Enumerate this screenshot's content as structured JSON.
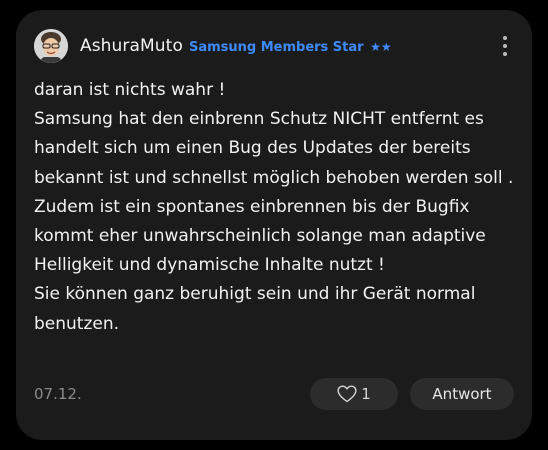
{
  "post": {
    "author": {
      "name": "AshuraMuto",
      "badge": "Samsung Members Star",
      "badge_stars": "★★",
      "avatar_icon": "memoji-avatar-icon"
    },
    "menu_icon": "more-vertical-icon",
    "lines": [
      "daran ist nichts wahr !",
      "Samsung hat den einbrenn Schutz NICHT entfernt es handelt sich um einen Bug des Updates der bereits bekannt ist und schnellst möglich behoben werden soll .",
      "Zudem ist ein spontanes einbrennen bis der Bugfix kommt eher unwahrscheinlich solange man adaptive Helligkeit und dynamische Inhalte nutzt !",
      "Sie können ganz beruhigt sein und ihr Gerät normal benutzen."
    ],
    "date": "07.12.",
    "like": {
      "icon": "heart-icon",
      "count": "1"
    },
    "reply_label": "Antwort"
  },
  "colors": {
    "background": "#000000",
    "card": "#1b1b1b",
    "accent": "#3d8bfd",
    "button": "#2c2c2c"
  }
}
